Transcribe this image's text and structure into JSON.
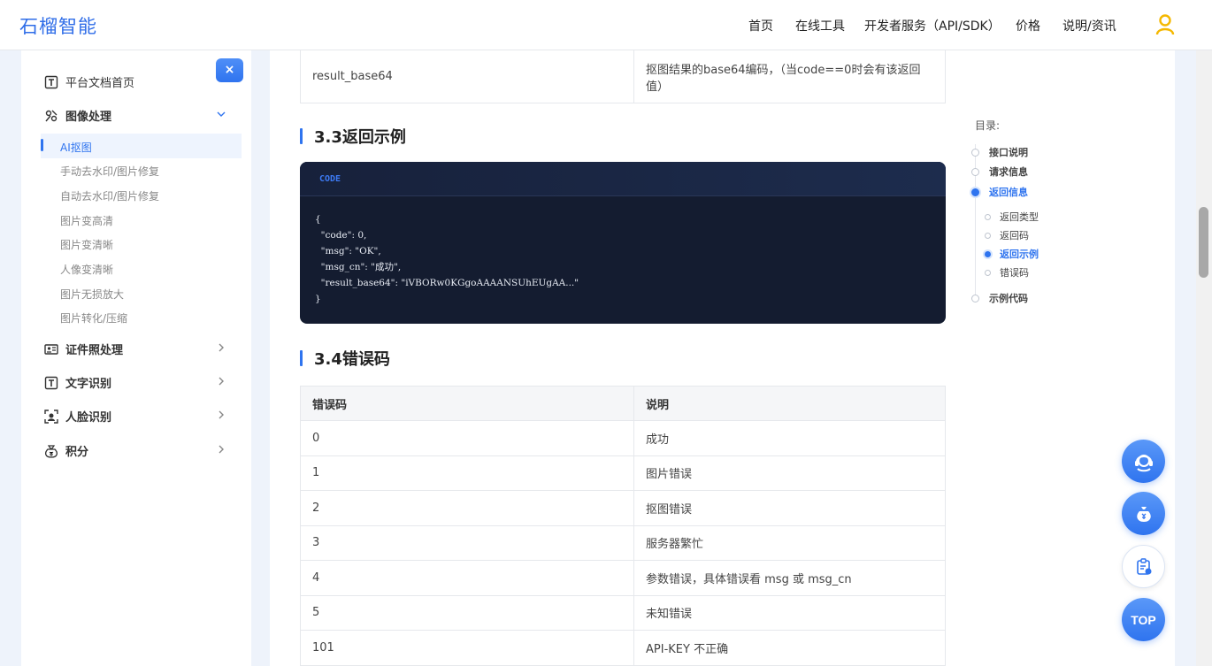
{
  "brand": {
    "logo": "石榴智能",
    "accent": "#2f74ef"
  },
  "topnav": {
    "items": [
      "首页",
      "在线工具",
      "开发者服务（API/SDK）",
      "价格",
      "说明/资讯"
    ]
  },
  "sidebar": {
    "close_label": "×",
    "home": "平台文档首页",
    "image_processing": "图像处理",
    "sub_items": [
      "AI抠图",
      "手动去水印/图片修复",
      "自动去水印/图片修复",
      "图片变高清",
      "图片变清晰",
      "人像变清晰",
      "图片无损放大",
      "图片转化/压缩"
    ],
    "active_sub": "AI抠图",
    "groups": [
      "证件照处理",
      "文字识别",
      "人脸识别",
      "积分"
    ]
  },
  "main": {
    "top_row": {
      "field": "result_base64",
      "desc": "抠图结果的base64编码，（当code==0时会有该返回值）"
    },
    "section_33": "3.3返回示例",
    "code_tag": "CODE",
    "code_text": "{\n  \"code\": 0,\n  \"msg\": \"OK\",\n  \"msg_cn\": \"成功\",\n  \"result_base64\": \"iVBORw0KGgoAAAANSUhEUgAA...\"\n}",
    "section_34": "3.4错误码",
    "err_table": {
      "headers": [
        "错误码",
        "说明"
      ],
      "rows": [
        [
          "0",
          "成功"
        ],
        [
          "1",
          "图片错误"
        ],
        [
          "2",
          "抠图错误"
        ],
        [
          "3",
          "服务器繁忙"
        ],
        [
          "4",
          "参数错误，具体错误看 msg 或 msg_cn"
        ],
        [
          "5",
          "未知错误"
        ],
        [
          "101",
          "API-KEY 不正确"
        ]
      ]
    }
  },
  "toc": {
    "title": "目录:",
    "items": [
      {
        "label": "接口说明",
        "level": 1,
        "active": false
      },
      {
        "label": "请求信息",
        "level": 1,
        "active": false
      },
      {
        "label": "返回信息",
        "level": 1,
        "active": true
      },
      {
        "label": "返回类型",
        "level": 2,
        "active": false
      },
      {
        "label": "返回码",
        "level": 2,
        "active": false
      },
      {
        "label": "返回示例",
        "level": 2,
        "active": true
      },
      {
        "label": "错误码",
        "level": 2,
        "active": false
      },
      {
        "label": "示例代码",
        "level": 1,
        "active": false
      }
    ]
  },
  "fabs": {
    "top_label": "TOP"
  }
}
